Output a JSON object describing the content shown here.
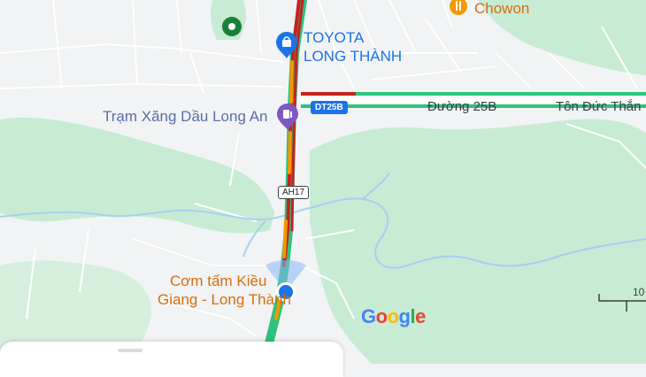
{
  "pois": {
    "chowon": "Chowon",
    "toyota_line1": "TOYOTA",
    "toyota_line2": "LONG THÀNH",
    "gas_station": "Trạm Xăng Dầu Long An",
    "restaurant_line1": "Cơm tấm Kiều",
    "restaurant_line2": "Giang - Long Thành"
  },
  "roads": {
    "duong_25b": "Đường 25B",
    "ton_duc_thang": "Tôn Đức Thắn",
    "shield_dt25b": "DT25B",
    "shield_ah17": "AH17"
  },
  "branding": {
    "logo_letters": [
      "G",
      "o",
      "o",
      "g",
      "l",
      "e"
    ],
    "logo_colors": [
      "#4285f4",
      "#ea4335",
      "#fbbc05",
      "#4285f4",
      "#34a853",
      "#ea4335"
    ]
  },
  "scale": {
    "text": "10"
  },
  "colors": {
    "traffic_green": "#2ec27e",
    "traffic_red": "#c5221f",
    "traffic_orange": "#f29900",
    "park_green": "#c8ebd4",
    "water": "#a7cff0",
    "location_blue": "#1a73e8"
  },
  "icons": [
    "restaurant-icon",
    "shopping-icon",
    "gas-station-icon",
    "place-icon",
    "current-location-icon"
  ]
}
